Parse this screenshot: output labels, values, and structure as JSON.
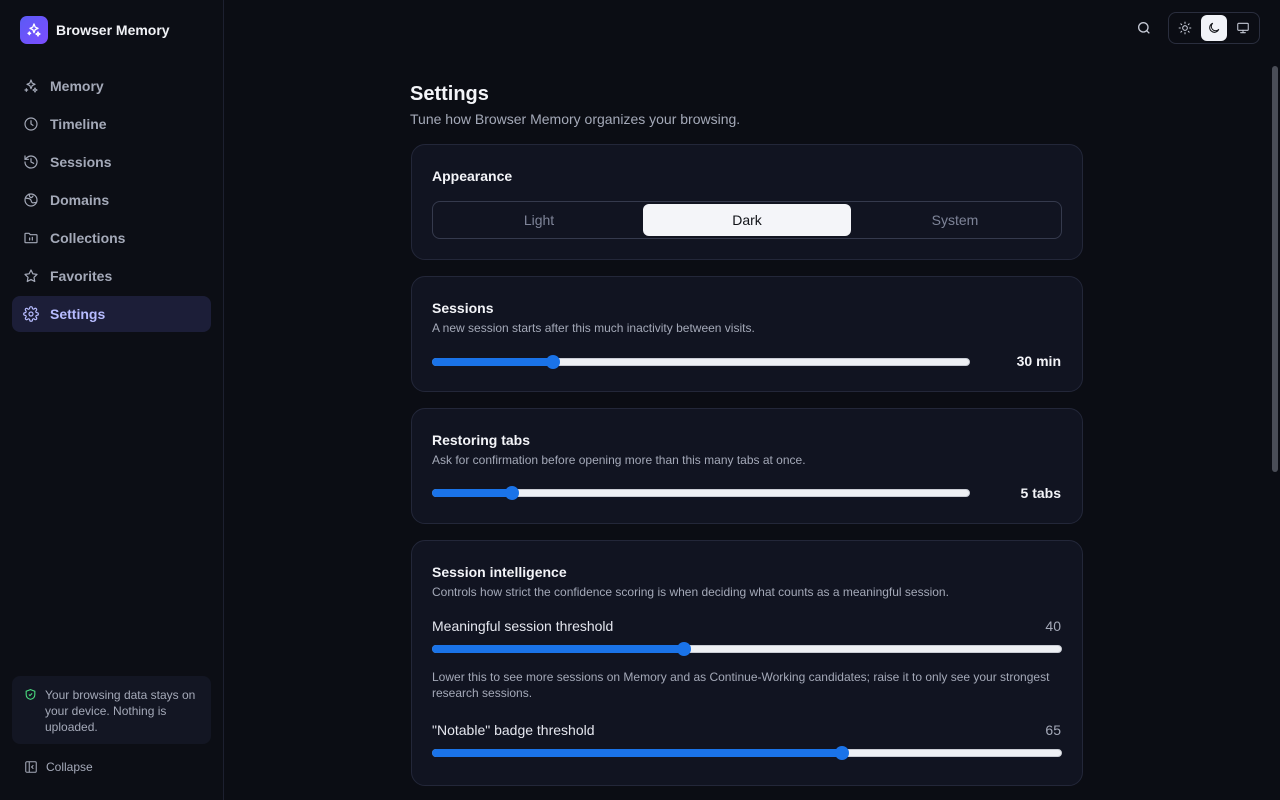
{
  "app": {
    "name": "Browser Memory",
    "accent": "#5b5bf5"
  },
  "sidebar": {
    "items": [
      {
        "label": "Memory",
        "icon": "sparkles-icon",
        "active": false
      },
      {
        "label": "Timeline",
        "icon": "clock-icon",
        "active": false
      },
      {
        "label": "Sessions",
        "icon": "history-icon",
        "active": false
      },
      {
        "label": "Domains",
        "icon": "globe-icon",
        "active": false
      },
      {
        "label": "Collections",
        "icon": "folder-icon",
        "active": false
      },
      {
        "label": "Favorites",
        "icon": "star-icon",
        "active": false
      },
      {
        "label": "Settings",
        "icon": "gear-icon",
        "active": true
      }
    ],
    "privacy_note": "Your browsing data stays on your device. Nothing is uploaded.",
    "collapse_label": "Collapse"
  },
  "topbar": {
    "search_icon": "search-icon",
    "theme_options": [
      {
        "icon": "sun-icon",
        "active": false
      },
      {
        "icon": "moon-icon",
        "active": true
      },
      {
        "icon": "monitor-icon",
        "active": false
      }
    ]
  },
  "page": {
    "title": "Settings",
    "subtitle": "Tune how Browser Memory organizes your browsing."
  },
  "appearance": {
    "title": "Appearance",
    "options": [
      "Light",
      "Dark",
      "System"
    ],
    "selected": "Dark"
  },
  "sessions": {
    "title": "Sessions",
    "description": "A new session starts after this much inactivity between visits.",
    "value_label": "30 min",
    "fraction": 0.225
  },
  "restoring_tabs": {
    "title": "Restoring tabs",
    "description": "Ask for confirmation before opening more than this many tabs at once.",
    "value_label": "5 tabs",
    "fraction": 0.148
  },
  "intelligence": {
    "title": "Session intelligence",
    "description": "Controls how strict the confidence scoring is when deciding what counts as a meaningful session.",
    "meaningful": {
      "label": "Meaningful session threshold",
      "value": "40",
      "fraction": 0.4,
      "help": "Lower this to see more sessions on Memory and as Continue-Working candidates; raise it to only see your strongest research sessions."
    },
    "notable": {
      "label": "\"Notable\" badge threshold",
      "value": "65",
      "fraction": 0.65
    }
  },
  "colors": {
    "slider": "#1a73e8",
    "active_nav_bg": "#1c1e38",
    "privacy_icon": "#4ade80"
  }
}
